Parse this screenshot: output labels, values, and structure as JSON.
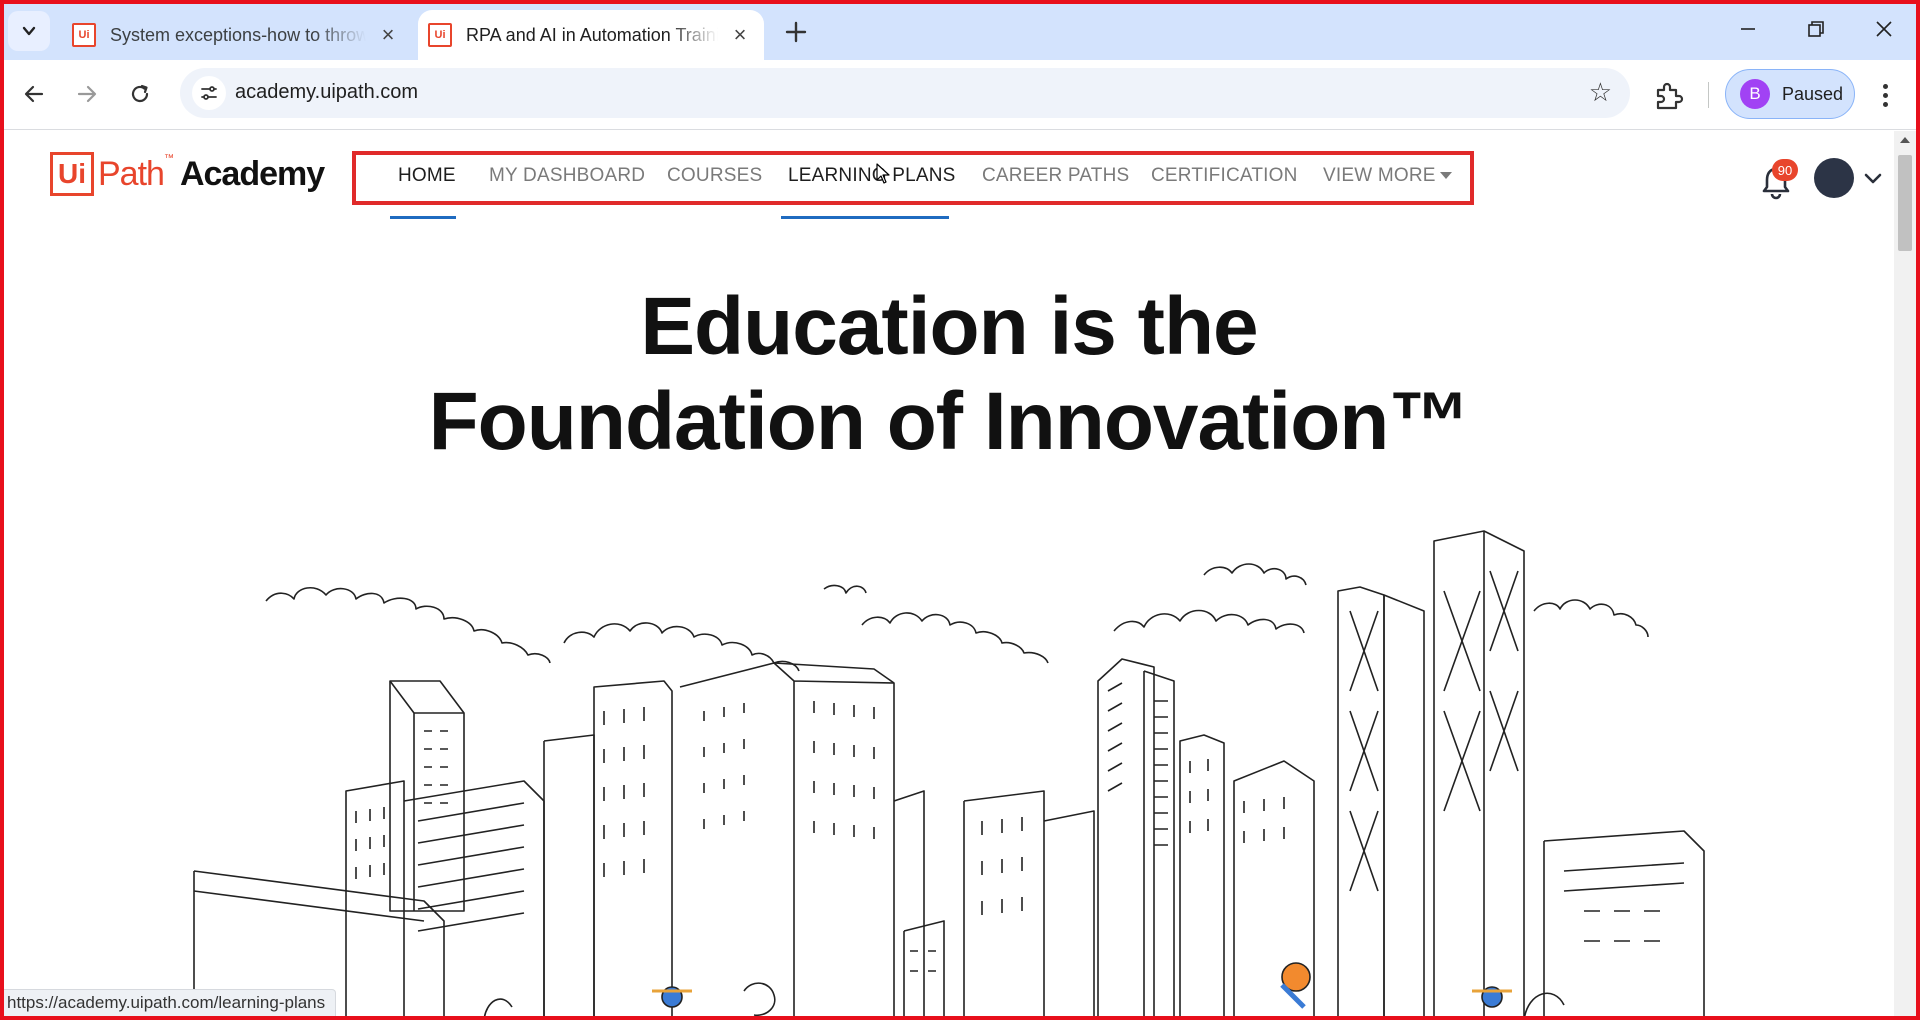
{
  "browser": {
    "tabs": [
      {
        "title": "System exceptions-how to throw",
        "favicon": "Ui",
        "active": false
      },
      {
        "title": "RPA and AI in Automation Training",
        "favicon": "Ui",
        "active": true
      }
    ],
    "address": "academy.uipath.com",
    "profile": {
      "initial": "B",
      "status": "Paused"
    },
    "status_url": "https://academy.uipath.com/learning-plans"
  },
  "site": {
    "logo": {
      "mark": "Ui",
      "path": "Path",
      "tm": "™",
      "academy": "Academy"
    },
    "nav": [
      {
        "label": "HOME",
        "state": "active"
      },
      {
        "label": "MY DASHBOARD",
        "state": "normal"
      },
      {
        "label": "COURSES",
        "state": "normal"
      },
      {
        "label": "LEARNING PLANS",
        "state": "hover"
      },
      {
        "label": "CAREER PATHS",
        "state": "normal"
      },
      {
        "label": "CERTIFICATION",
        "state": "normal"
      },
      {
        "label": "VIEW MORE",
        "state": "dropdown"
      }
    ],
    "notifications_count": "90",
    "hero": {
      "line1": "Education is the",
      "line2": "Foundation of Innovation™"
    }
  },
  "colors": {
    "brand_orange": "#e8452c",
    "nav_underline": "#1f6bc0",
    "highlight_border": "#e02a2a"
  }
}
